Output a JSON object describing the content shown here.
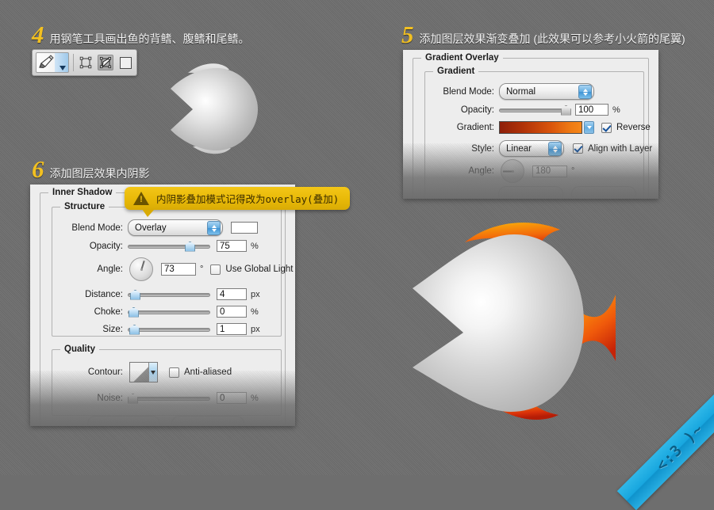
{
  "page": {
    "bg_color": "#6e6e6e",
    "accent_number_color": "#f2c021"
  },
  "steps": [
    {
      "number": "4",
      "title": "用钢笔工具画出鱼的背鳍、腹鳍和尾鳍。",
      "toolbar": {
        "tools": [
          {
            "name": "pen-tool",
            "label": "Pen Tool"
          },
          {
            "name": "path-selection-tool",
            "label": "Path Selection"
          },
          {
            "name": "direct-selection-tool",
            "label": "Direct Selection"
          },
          {
            "name": "shape-tool",
            "label": "Shape"
          }
        ]
      }
    },
    {
      "number": "5",
      "title": "添加图层效果渐变叠加 (此效果可以参考小火箭的尾翼)"
    },
    {
      "number": "6",
      "title": "添加图层效果内阴影"
    }
  ],
  "gradient_overlay_panel": {
    "title": "Gradient Overlay",
    "group_title": "Gradient",
    "rows": {
      "blend_mode_label": "Blend Mode:",
      "blend_mode_value": "Normal",
      "opacity_label": "Opacity:",
      "opacity_value": "100",
      "opacity_unit": "%",
      "gradient_label": "Gradient:",
      "gradient_colors": [
        "#8e1f09",
        "#b03208",
        "#d9540c",
        "#f07c14",
        "#f6871a"
      ],
      "reverse_label": "Reverse",
      "reverse_checked": true,
      "style_label": "Style:",
      "style_value": "Linear",
      "align_label": "Align with Layer",
      "align_checked": true,
      "angle_label": "Angle:",
      "angle_value": "180",
      "angle_unit": "°"
    }
  },
  "inner_shadow_panel": {
    "title": "Inner Shadow",
    "structure_title": "Structure",
    "quality_title": "Quality",
    "rows": {
      "blend_mode_label": "Blend Mode:",
      "blend_mode_value": "Overlay",
      "opacity_label": "Opacity:",
      "opacity_value": "75",
      "opacity_unit": "%",
      "angle_label": "Angle:",
      "angle_value": "73",
      "angle_unit": "°",
      "use_global_light_label": "Use Global Light",
      "use_global_light_checked": false,
      "distance_label": "Distance:",
      "distance_value": "4",
      "distance_unit": "px",
      "choke_label": "Choke:",
      "choke_value": "0",
      "choke_unit": "%",
      "size_label": "Size:",
      "size_value": "1",
      "size_unit": "px",
      "contour_label": "Contour:",
      "anti_aliased_label": "Anti-aliased",
      "anti_aliased_checked": false,
      "noise_label": "Noise:",
      "noise_value": "0",
      "noise_unit": "%"
    }
  },
  "callout": {
    "text": "内阴影叠加模式记得改为overlay(叠加)",
    "bg_color": "#e8b908",
    "icon": "warning-triangle-icon"
  },
  "corner_ribbon": {
    "text": "<:3 )~",
    "color": "#18a7df"
  },
  "illustrations": [
    {
      "name": "fish-grey",
      "description": "grey fish with radial highlight"
    },
    {
      "name": "fish-orange-fins",
      "description": "grey fish body with orange gradient fins"
    }
  ]
}
